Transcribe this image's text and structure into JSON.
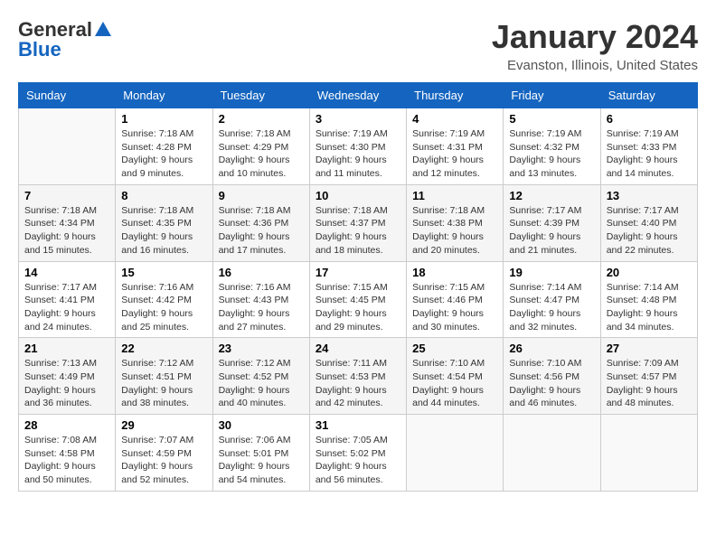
{
  "header": {
    "logo": {
      "general": "General",
      "blue": "Blue"
    },
    "title": "January 2024",
    "location": "Evanston, Illinois, United States"
  },
  "days_of_week": [
    "Sunday",
    "Monday",
    "Tuesday",
    "Wednesday",
    "Thursday",
    "Friday",
    "Saturday"
  ],
  "weeks": [
    [
      {
        "day": "",
        "info": ""
      },
      {
        "day": "1",
        "info": "Sunrise: 7:18 AM\nSunset: 4:28 PM\nDaylight: 9 hours\nand 9 minutes."
      },
      {
        "day": "2",
        "info": "Sunrise: 7:18 AM\nSunset: 4:29 PM\nDaylight: 9 hours\nand 10 minutes."
      },
      {
        "day": "3",
        "info": "Sunrise: 7:19 AM\nSunset: 4:30 PM\nDaylight: 9 hours\nand 11 minutes."
      },
      {
        "day": "4",
        "info": "Sunrise: 7:19 AM\nSunset: 4:31 PM\nDaylight: 9 hours\nand 12 minutes."
      },
      {
        "day": "5",
        "info": "Sunrise: 7:19 AM\nSunset: 4:32 PM\nDaylight: 9 hours\nand 13 minutes."
      },
      {
        "day": "6",
        "info": "Sunrise: 7:19 AM\nSunset: 4:33 PM\nDaylight: 9 hours\nand 14 minutes."
      }
    ],
    [
      {
        "day": "7",
        "info": "Sunrise: 7:18 AM\nSunset: 4:34 PM\nDaylight: 9 hours\nand 15 minutes."
      },
      {
        "day": "8",
        "info": "Sunrise: 7:18 AM\nSunset: 4:35 PM\nDaylight: 9 hours\nand 16 minutes."
      },
      {
        "day": "9",
        "info": "Sunrise: 7:18 AM\nSunset: 4:36 PM\nDaylight: 9 hours\nand 17 minutes."
      },
      {
        "day": "10",
        "info": "Sunrise: 7:18 AM\nSunset: 4:37 PM\nDaylight: 9 hours\nand 18 minutes."
      },
      {
        "day": "11",
        "info": "Sunrise: 7:18 AM\nSunset: 4:38 PM\nDaylight: 9 hours\nand 20 minutes."
      },
      {
        "day": "12",
        "info": "Sunrise: 7:17 AM\nSunset: 4:39 PM\nDaylight: 9 hours\nand 21 minutes."
      },
      {
        "day": "13",
        "info": "Sunrise: 7:17 AM\nSunset: 4:40 PM\nDaylight: 9 hours\nand 22 minutes."
      }
    ],
    [
      {
        "day": "14",
        "info": "Sunrise: 7:17 AM\nSunset: 4:41 PM\nDaylight: 9 hours\nand 24 minutes."
      },
      {
        "day": "15",
        "info": "Sunrise: 7:16 AM\nSunset: 4:42 PM\nDaylight: 9 hours\nand 25 minutes."
      },
      {
        "day": "16",
        "info": "Sunrise: 7:16 AM\nSunset: 4:43 PM\nDaylight: 9 hours\nand 27 minutes."
      },
      {
        "day": "17",
        "info": "Sunrise: 7:15 AM\nSunset: 4:45 PM\nDaylight: 9 hours\nand 29 minutes."
      },
      {
        "day": "18",
        "info": "Sunrise: 7:15 AM\nSunset: 4:46 PM\nDaylight: 9 hours\nand 30 minutes."
      },
      {
        "day": "19",
        "info": "Sunrise: 7:14 AM\nSunset: 4:47 PM\nDaylight: 9 hours\nand 32 minutes."
      },
      {
        "day": "20",
        "info": "Sunrise: 7:14 AM\nSunset: 4:48 PM\nDaylight: 9 hours\nand 34 minutes."
      }
    ],
    [
      {
        "day": "21",
        "info": "Sunrise: 7:13 AM\nSunset: 4:49 PM\nDaylight: 9 hours\nand 36 minutes."
      },
      {
        "day": "22",
        "info": "Sunrise: 7:12 AM\nSunset: 4:51 PM\nDaylight: 9 hours\nand 38 minutes."
      },
      {
        "day": "23",
        "info": "Sunrise: 7:12 AM\nSunset: 4:52 PM\nDaylight: 9 hours\nand 40 minutes."
      },
      {
        "day": "24",
        "info": "Sunrise: 7:11 AM\nSunset: 4:53 PM\nDaylight: 9 hours\nand 42 minutes."
      },
      {
        "day": "25",
        "info": "Sunrise: 7:10 AM\nSunset: 4:54 PM\nDaylight: 9 hours\nand 44 minutes."
      },
      {
        "day": "26",
        "info": "Sunrise: 7:10 AM\nSunset: 4:56 PM\nDaylight: 9 hours\nand 46 minutes."
      },
      {
        "day": "27",
        "info": "Sunrise: 7:09 AM\nSunset: 4:57 PM\nDaylight: 9 hours\nand 48 minutes."
      }
    ],
    [
      {
        "day": "28",
        "info": "Sunrise: 7:08 AM\nSunset: 4:58 PM\nDaylight: 9 hours\nand 50 minutes."
      },
      {
        "day": "29",
        "info": "Sunrise: 7:07 AM\nSunset: 4:59 PM\nDaylight: 9 hours\nand 52 minutes."
      },
      {
        "day": "30",
        "info": "Sunrise: 7:06 AM\nSunset: 5:01 PM\nDaylight: 9 hours\nand 54 minutes."
      },
      {
        "day": "31",
        "info": "Sunrise: 7:05 AM\nSunset: 5:02 PM\nDaylight: 9 hours\nand 56 minutes."
      },
      {
        "day": "",
        "info": ""
      },
      {
        "day": "",
        "info": ""
      },
      {
        "day": "",
        "info": ""
      }
    ]
  ]
}
